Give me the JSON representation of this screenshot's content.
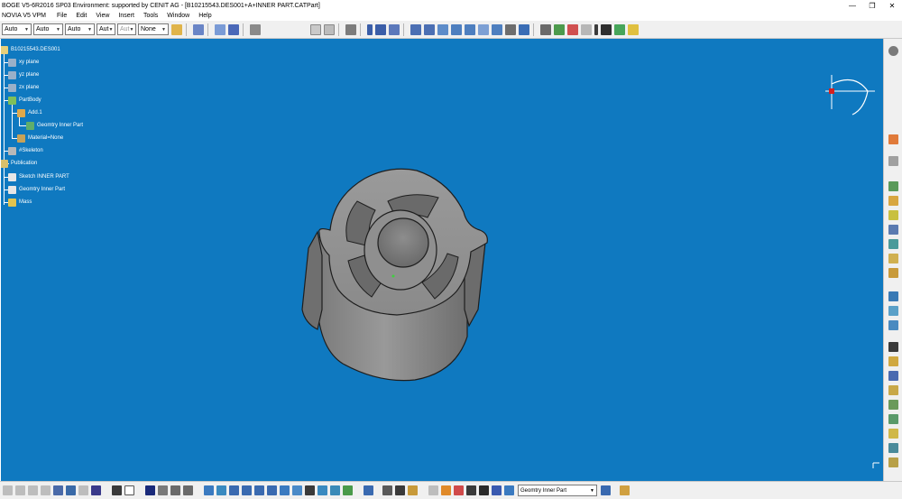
{
  "window": {
    "title": "BOGE V5-6R2016 SP03 Environment: supported by CENIT AG - [B10215543.DES001+A+INNER PART.CATPart]",
    "minimize_glyph": "—",
    "restore_glyph": "❐",
    "close_glyph": "✕"
  },
  "menu": {
    "items": [
      "NOVIA V5 VPM",
      "File",
      "Edit",
      "View",
      "Insert",
      "Tools",
      "Window",
      "Help"
    ]
  },
  "toolbar": {
    "combos": [
      "Auto",
      "Auto",
      "Auto",
      "Aut",
      "Aut",
      "None"
    ],
    "icon_names": [
      "paint-icon",
      "snap-icon",
      "layer-icon",
      "grid-icon",
      "compass-icon",
      "sketch-icon",
      "part-icon",
      "point-icon",
      "line-icon",
      "curve-icon",
      "rotate-icon",
      "fillet-icon",
      "pad-icon",
      "pocket-icon",
      "shaft-icon",
      "groove-icon",
      "hole-icon",
      "rib-icon",
      "slot-icon",
      "measure-icon",
      "sort-icon",
      "constraint-icon",
      "axis-icon",
      "plane-icon",
      "sweep-icon",
      "update-icon"
    ]
  },
  "tree": {
    "root": "B10215543.DES001",
    "items": [
      {
        "label": "xy plane",
        "icon": "plane-icon"
      },
      {
        "label": "yz plane",
        "icon": "plane-icon"
      },
      {
        "label": "zx plane",
        "icon": "plane-icon"
      },
      {
        "label": "PartBody",
        "icon": "partbody-icon"
      },
      {
        "label": "Add.1",
        "icon": "add-icon"
      },
      {
        "label": "Geomtry Inner Part",
        "icon": "body-icon"
      },
      {
        "label": "Material=None",
        "icon": "material-icon"
      },
      {
        "label": "#Skeleton",
        "icon": "skeleton-icon"
      },
      {
        "label": "Publication",
        "icon": "publication-icon"
      },
      {
        "label": "Sketch INNER PART",
        "icon": "publication-item-icon"
      },
      {
        "label": "Geomtry Inner Part",
        "icon": "publication-item-icon"
      },
      {
        "label": "Mass",
        "icon": "mass-icon"
      }
    ]
  },
  "bottombar": {
    "current_body": "Geomtry Inner Part"
  },
  "colors": {
    "viewport": "#0f79c0",
    "part": "#8e8e8e"
  }
}
